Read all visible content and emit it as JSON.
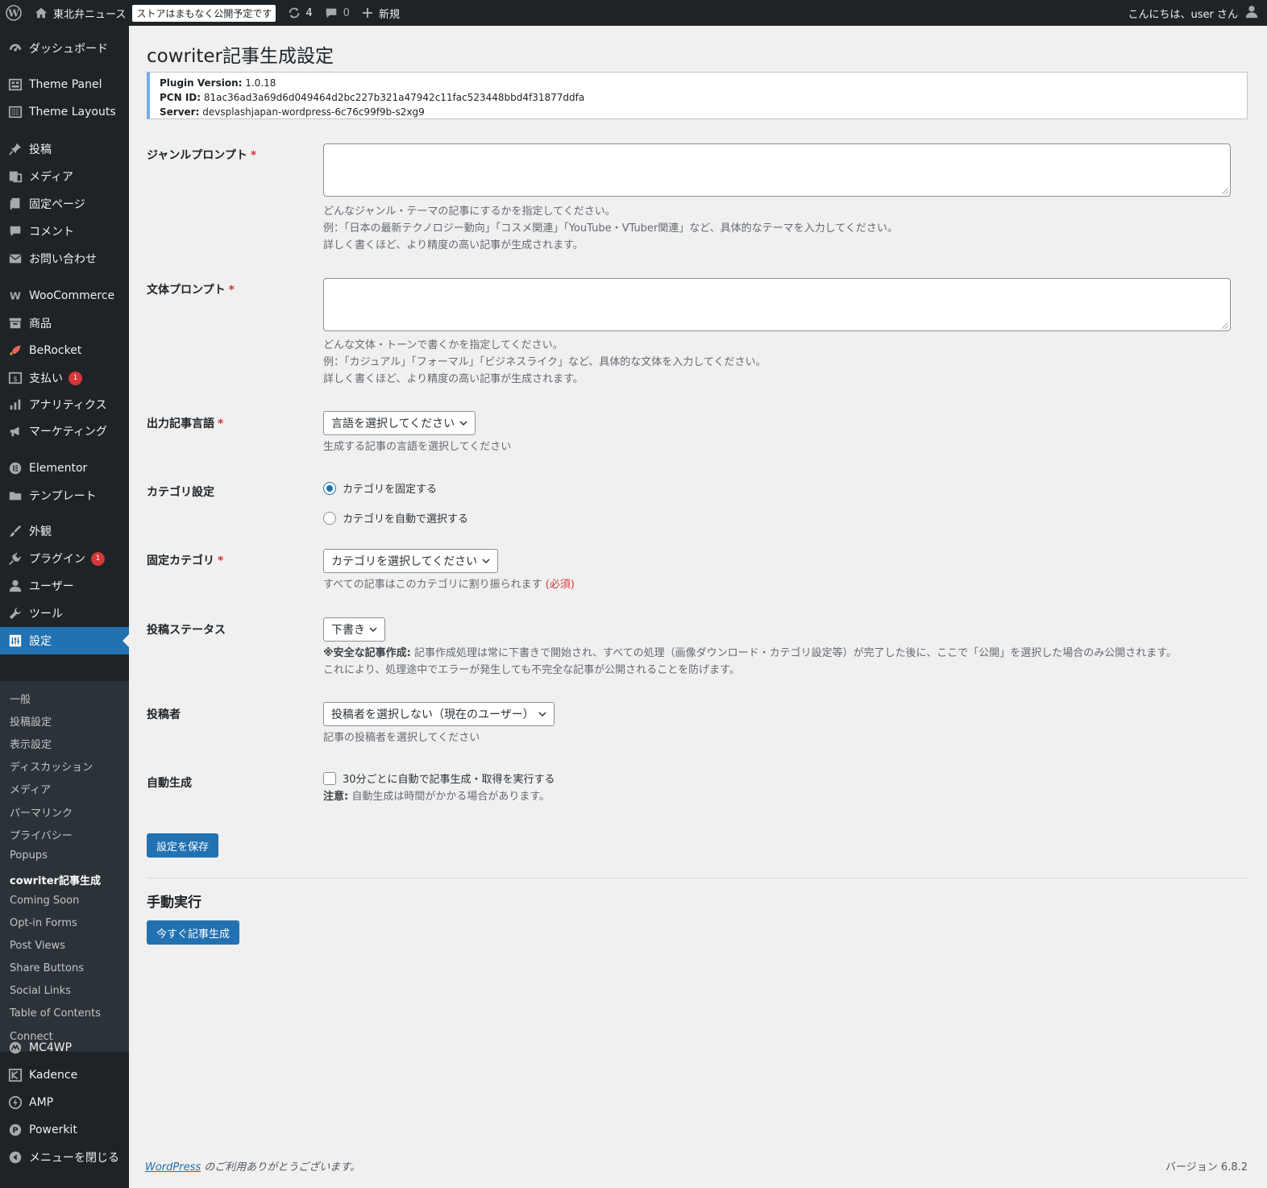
{
  "admin_bar": {
    "site_name": "東北弁ニュース",
    "store_notice": "ストアはまもなく公開予定です",
    "updates_count": "4",
    "comments_count": "0",
    "new_label": "新規",
    "greeting": "こんにちは、user さん"
  },
  "sidebar": {
    "items": [
      {
        "label": "ダッシュボード",
        "icon": "dashboard-icon"
      },
      {
        "label": "Theme Panel",
        "icon": "theme-panel-icon"
      },
      {
        "label": "Theme Layouts",
        "icon": "theme-layouts-icon"
      },
      {
        "label": "投稿",
        "icon": "pin-icon"
      },
      {
        "label": "メディア",
        "icon": "media-icon"
      },
      {
        "label": "固定ページ",
        "icon": "page-icon"
      },
      {
        "label": "コメント",
        "icon": "comment-icon"
      },
      {
        "label": "お問い合わせ",
        "icon": "mail-icon"
      },
      {
        "label": "WooCommerce",
        "icon": "woocommerce-icon"
      },
      {
        "label": "商品",
        "icon": "archive-icon"
      },
      {
        "label": "BeRocket",
        "icon": "rocket-icon"
      },
      {
        "label": "支払い",
        "icon": "payment-icon",
        "badge": "1"
      },
      {
        "label": "アナリティクス",
        "icon": "bar-chart-icon"
      },
      {
        "label": "マーケティング",
        "icon": "megaphone-icon"
      },
      {
        "label": "Elementor",
        "icon": "elementor-icon"
      },
      {
        "label": "テンプレート",
        "icon": "folder-icon"
      },
      {
        "label": "外観",
        "icon": "brush-icon"
      },
      {
        "label": "プラグイン",
        "icon": "plugin-icon",
        "badge": "1"
      },
      {
        "label": "ユーザー",
        "icon": "user-icon"
      },
      {
        "label": "ツール",
        "icon": "wrench-icon"
      },
      {
        "label": "設定",
        "icon": "settings-icon"
      },
      {
        "label": "MC4WP",
        "icon": "mc4wp-icon"
      },
      {
        "label": "Kadence",
        "icon": "kadence-icon"
      },
      {
        "label": "AMP",
        "icon": "amp-icon"
      },
      {
        "label": "Powerkit",
        "icon": "powerkit-icon"
      },
      {
        "label": "メニューを閉じる",
        "icon": "collapse-icon"
      }
    ],
    "submenu": [
      "一般",
      "投稿設定",
      "表示設定",
      "ディスカッション",
      "メディア",
      "パーマリンク",
      "プライバシー",
      "Popups",
      "cowriter記事生成",
      "Coming Soon",
      "Opt-in Forms",
      "Post Views",
      "Share Buttons",
      "Social Links",
      "Table of Contents",
      "Connect"
    ]
  },
  "page": {
    "title": "cowriter記事生成設定",
    "notice": {
      "version_label": "Plugin Version:",
      "version_value": "1.0.18",
      "pcn_label": "PCN ID:",
      "pcn_value": "81ac36ad3a69d6d049464d2bc227b321a47942c11fac523448bbd4f31877ddfa",
      "server_label": "Server:",
      "server_value": "devsplashjapan-wordpress-6c76c99f9b-s2xg9"
    },
    "required_mark": "*",
    "genre": {
      "label": "ジャンルプロンプト",
      "value": "",
      "desc": [
        "どんなジャンル・テーマの記事にするかを指定してください。",
        "例：「日本の最新テクノロジー動向」「コスメ関連」「YouTube・VTuber関連」など、具体的なテーマを入力してください。",
        "詳しく書くほど、より精度の高い記事が生成されます。"
      ]
    },
    "style": {
      "label": "文体プロンプト",
      "value": "",
      "desc": [
        "どんな文体・トーンで書くかを指定してください。",
        "例：「カジュアル」「フォーマル」「ビジネスライク」など、具体的な文体を入力してください。",
        "詳しく書くほど、より精度の高い記事が生成されます。"
      ]
    },
    "language": {
      "label": "出力記事言語",
      "selected": "言語を選択してください",
      "desc": "生成する記事の言語を選択してください"
    },
    "category_setting": {
      "label": "カテゴリ設定",
      "option_fixed": "カテゴリを固定する",
      "option_auto": "カテゴリを自動で選択する"
    },
    "fixed_category": {
      "label": "固定カテゴリ",
      "selected": "カテゴリを選択してください",
      "desc": "すべての記事はこのカテゴリに割り振られます",
      "required_note": "(必須)"
    },
    "post_status": {
      "label": "投稿ステータス",
      "selected": "下書き",
      "note_bold": "※安全な記事作成:",
      "note_text": "記事作成処理は常に下書きで開始され、すべての処理（画像ダウンロード・カテゴリ設定等）が完了した後に、ここで「公開」を選択した場合のみ公開されます。",
      "note_line2": "これにより、処理途中でエラーが発生しても不完全な記事が公開されることを防げます。"
    },
    "author": {
      "label": "投稿者",
      "selected": "投稿者を選択しない（現在のユーザー）",
      "desc": "記事の投稿者を選択してください"
    },
    "auto_generate": {
      "label": "自動生成",
      "checkbox_label": "30分ごとに自動で記事生成・取得を実行する",
      "note_bold": "注意:",
      "note_text": "自動生成は時間がかかる場合があります。"
    },
    "save_button": "設定を保存",
    "manual_title": "手動実行",
    "generate_button": "今すぐ記事生成"
  },
  "footer": {
    "link_text": "WordPress",
    "thanks": "のご利用ありがとうございます。",
    "version": "バージョン 6.8.2"
  }
}
